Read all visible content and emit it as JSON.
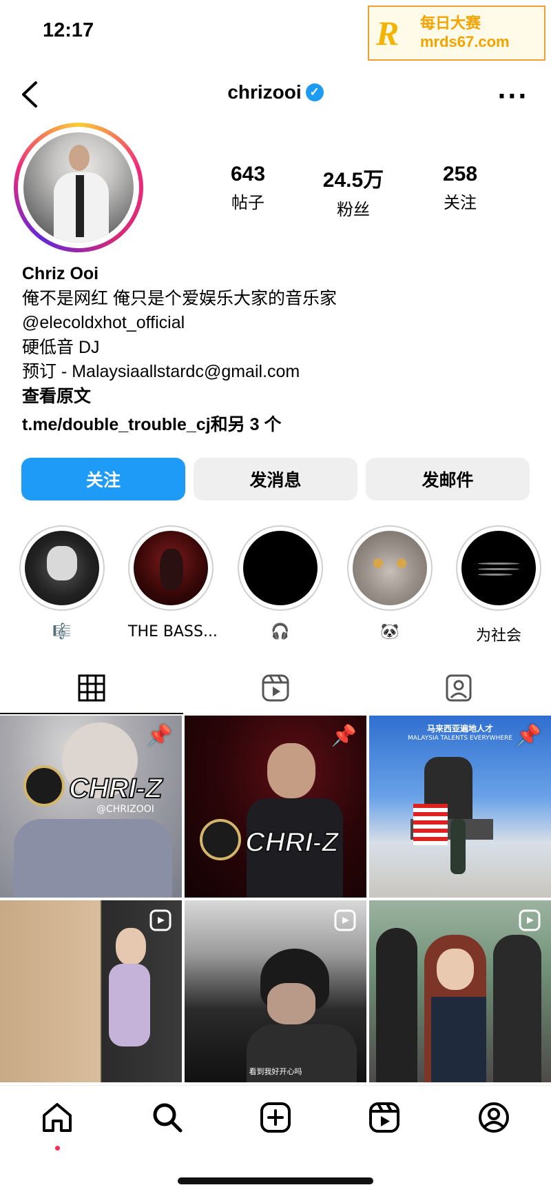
{
  "status_bar": {
    "time": "12:17"
  },
  "watermark": {
    "logo_letter": "R",
    "line1": "每日大赛",
    "line2": "mrds67.com"
  },
  "header": {
    "username": "chrizooi",
    "verified_glyph": "✓",
    "more_glyph": "···"
  },
  "stats": [
    {
      "number": "643",
      "label": "帖子"
    },
    {
      "number": "24.5万",
      "label": "粉丝"
    },
    {
      "number": "258",
      "label": "关注"
    }
  ],
  "bio": {
    "name": "Chriz Ooi",
    "lines": [
      "俺不是网红 俺只是个爱娱乐大家的音乐家",
      "@elecoldxhot_official",
      "硬低音 DJ",
      "预订 - Malaysiaallstardc@gmail.com"
    ],
    "see_original": "查看原文",
    "link": "t.me/double_trouble_cj和另 3 个"
  },
  "buttons": {
    "follow": "关注",
    "message": "发消息",
    "email": "发邮件"
  },
  "highlights": [
    {
      "label": "🎼"
    },
    {
      "label": "THE BASS..."
    },
    {
      "label": "🎧"
    },
    {
      "label": "🐼"
    },
    {
      "label": "为社会"
    }
  ],
  "grid": {
    "cell1_logo": "CHRI-Z",
    "cell1_handle": "@CHRIZOOI",
    "cell2_logo": "CHRI-Z",
    "cell3_title": "马来西亚遍地人才",
    "cell3_subtitle": "MALAYSIA TALENTS EVERYWHERE",
    "cell5_caption": "看到我好开心吗"
  },
  "colors": {
    "accent": "#1e9bf7",
    "button_bg": "#efefef",
    "story_dot": "#ff2d55"
  }
}
